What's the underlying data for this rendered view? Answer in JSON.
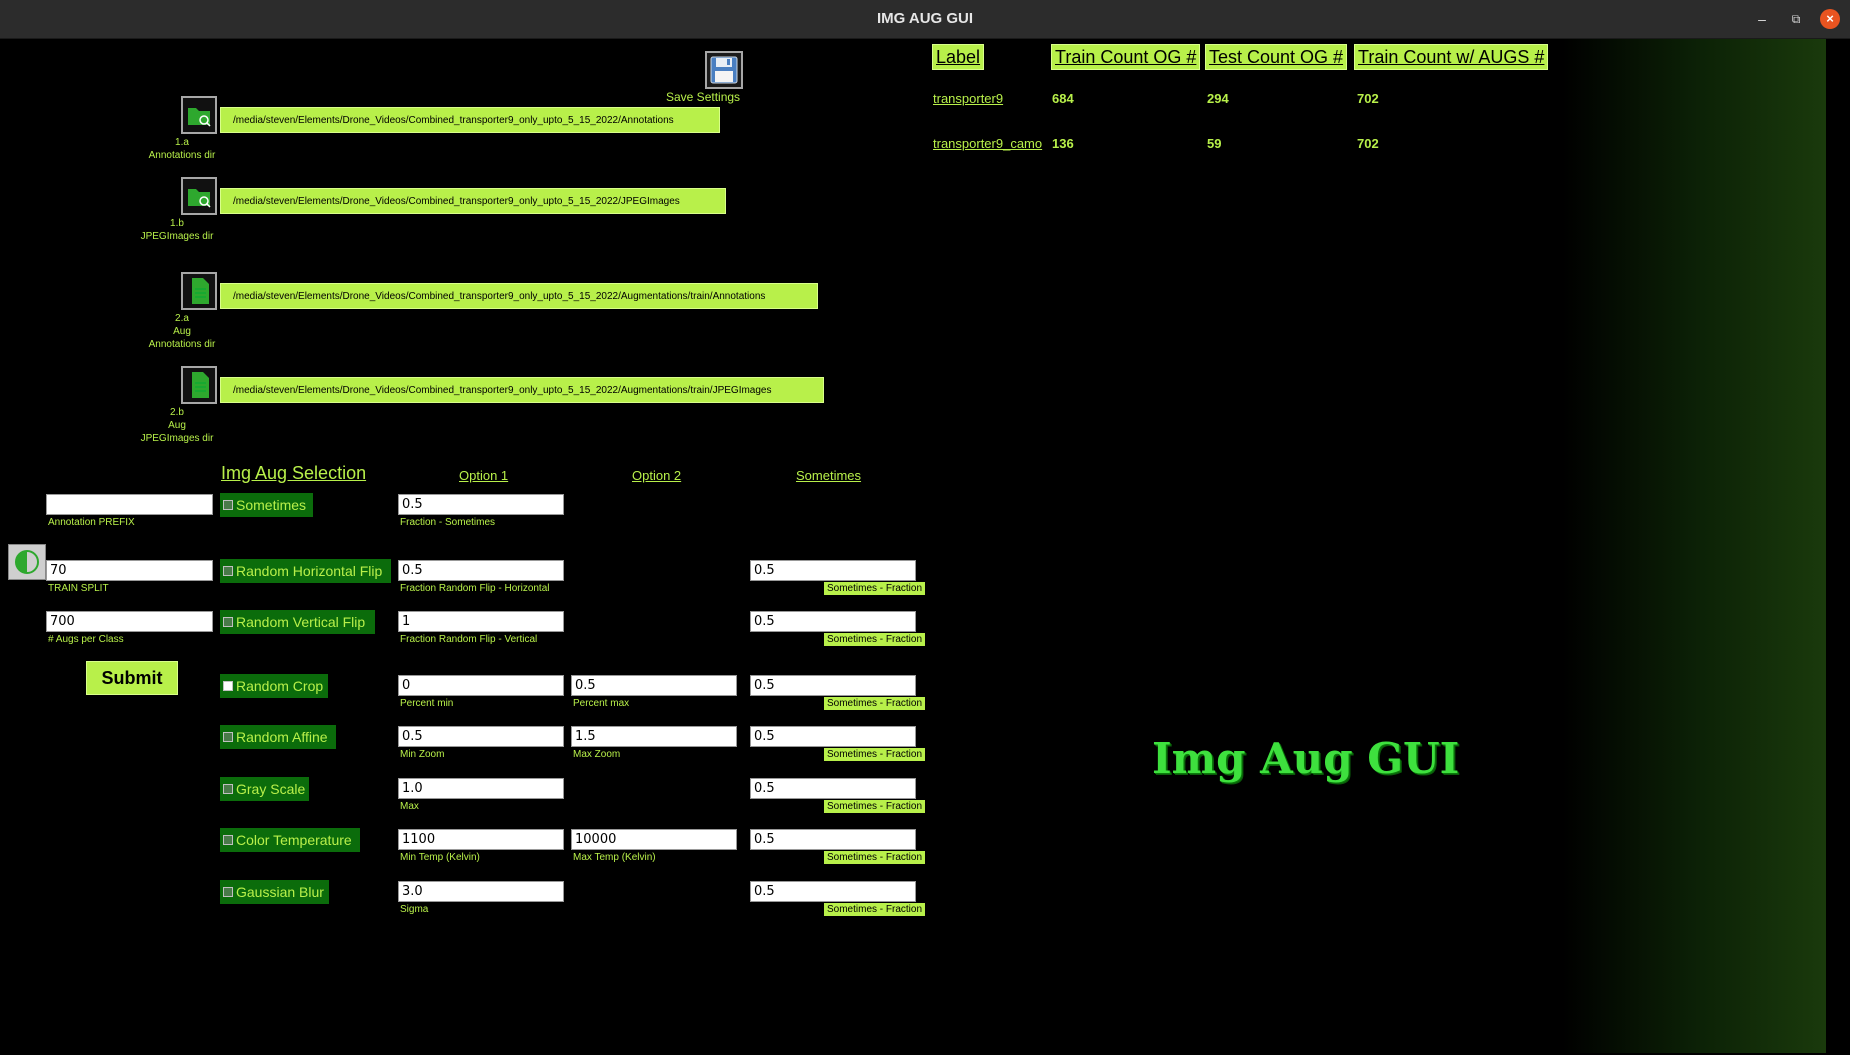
{
  "window": {
    "title": "IMG AUG GUI",
    "minimize": "–",
    "maximize": "⧉",
    "close": "×"
  },
  "save": {
    "label": "Save Settings"
  },
  "dirs": [
    {
      "num": "1.a",
      "name": "Annotations dir",
      "path": "/media/steven/Elements/Drone_Videos/Combined_transporter9_only_upto_5_15_2022/Annotations"
    },
    {
      "num": "1.b",
      "name": "JPEGImages dir",
      "path": "/media/steven/Elements/Drone_Videos/Combined_transporter9_only_upto_5_15_2022/JPEGImages"
    },
    {
      "num": "2.a",
      "sub": "Aug",
      "name": "Annotations dir",
      "path": "/media/steven/Elements/Drone_Videos/Combined_transporter9_only_upto_5_15_2022/Augmentations/train/Annotations"
    },
    {
      "num": "2.b",
      "sub": "Aug",
      "name": "JPEGImages dir",
      "path": "/media/steven/Elements/Drone_Videos/Combined_transporter9_only_upto_5_15_2022/Augmentations/train/JPEGImages"
    }
  ],
  "left": {
    "prefix": {
      "value": "",
      "label": "Annotation PREFIX"
    },
    "split": {
      "value": "70",
      "label": "TRAIN SPLIT"
    },
    "augs": {
      "value": "700",
      "label": "# Augs per Class"
    },
    "submit": "Submit"
  },
  "headers": {
    "selection": "Img Aug Selection",
    "opt1": "Option 1",
    "opt2": "Option 2",
    "sometimes": "Sometimes"
  },
  "augs": [
    {
      "name": "Sometimes",
      "checked": false,
      "opt1": "0.5",
      "opt1_label": "Fraction - Sometimes",
      "opt2": "",
      "opt2_label": "",
      "some": "",
      "some_label": ""
    },
    {
      "name": "Random Horizontal Flip",
      "checked": false,
      "opt1": "0.5",
      "opt1_label": "Fraction Random Flip - Horizontal",
      "opt2": "",
      "opt2_label": "",
      "some": "0.5",
      "some_label": "Sometimes - Fraction"
    },
    {
      "name": "Random Vertical Flip",
      "checked": false,
      "opt1": "1",
      "opt1_label": "Fraction Random Flip - Vertical",
      "opt2": "",
      "opt2_label": "",
      "some": "0.5",
      "some_label": "Sometimes - Fraction"
    },
    {
      "name": "Random Crop",
      "checked": true,
      "opt1": "0",
      "opt1_label": "Percent min",
      "opt2": "0.5",
      "opt2_label": "Percent max",
      "some": "0.5",
      "some_label": "Sometimes - Fraction"
    },
    {
      "name": "Random Affine",
      "checked": false,
      "opt1": "0.5",
      "opt1_label": "Min Zoom",
      "opt2": "1.5",
      "opt2_label": "Max Zoom",
      "some": "0.5",
      "some_label": "Sometimes - Fraction"
    },
    {
      "name": "Gray Scale",
      "checked": false,
      "opt1": "1.0",
      "opt1_label": "Max",
      "opt2": "",
      "opt2_label": "",
      "some": "0.5",
      "some_label": "Sometimes - Fraction"
    },
    {
      "name": "Color Temperature",
      "checked": false,
      "opt1": "1100",
      "opt1_label": "Min Temp (Kelvin)",
      "opt2": "10000",
      "opt2_label": "Max Temp (Kelvin)",
      "some": "0.5",
      "some_label": "Sometimes - Fraction"
    },
    {
      "name": "Gaussian Blur",
      "checked": false,
      "opt1": "3.0",
      "opt1_label": "Sigma",
      "opt2": "",
      "opt2_label": "",
      "some": "0.5",
      "some_label": "Sometimes - Fraction"
    }
  ],
  "table": {
    "headers": [
      "Label",
      "Train Count OG #",
      "Test Count OG #",
      "Train Count w/ AUGS #"
    ],
    "rows": [
      {
        "label": "transporter9",
        "train": "684",
        "test": "294",
        "augs": "702"
      },
      {
        "label": "transporter9_camo",
        "train": "136",
        "test": "59",
        "augs": "702"
      }
    ]
  },
  "logo": "Img Aug GUI"
}
